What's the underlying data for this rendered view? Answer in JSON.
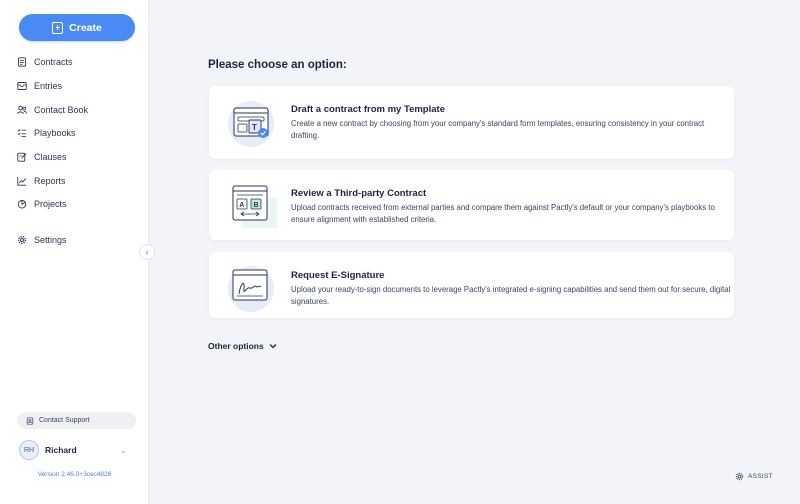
{
  "sidebar": {
    "create_label": "Create",
    "items": [
      {
        "label": "Contracts",
        "icon": "contract-icon"
      },
      {
        "label": "Entries",
        "icon": "entries-icon"
      },
      {
        "label": "Contact Book",
        "icon": "contact-book-icon"
      },
      {
        "label": "Playbooks",
        "icon": "playbooks-icon"
      },
      {
        "label": "Clauses",
        "icon": "clauses-icon"
      },
      {
        "label": "Reports",
        "icon": "reports-icon"
      },
      {
        "label": "Projects",
        "icon": "projects-icon"
      },
      {
        "label": "Settings",
        "icon": "gear-icon"
      }
    ],
    "collapse_icon": "chevron-left-icon",
    "support_label": "Contact Support",
    "user": {
      "initials": "RH",
      "name": "Richard"
    },
    "version": "Version 2.46.0+3cec4826"
  },
  "main": {
    "heading": "Please choose an option:",
    "options": [
      {
        "title": "Draft a contract from my Template",
        "description": "Create a new contract by choosing from your company's standard form templates, ensuring consistency in your contract drafting.",
        "illustration": "template-illustration"
      },
      {
        "title": "Review a Third-party Contract",
        "description": "Upload contracts received from external parties and compare them against Pactly's default or your company's playbooks to ensure alignment with established criteria.",
        "illustration": "compare-illustration",
        "compare_labels": [
          "A",
          "B"
        ]
      },
      {
        "title": "Request E-Signature",
        "description": "Upload your ready-to-sign documents to leverage Pactly's integrated e-signing capabilities and send them out for secure, digital signatures.",
        "illustration": "signature-illustration"
      }
    ],
    "other_options": "Other options",
    "assist_label": "ASSIST"
  },
  "colors": {
    "accent": "#4a8af4",
    "text": "#1c2540",
    "background": "#f3f4f8",
    "illustration_bg": "#e7ecfb"
  }
}
